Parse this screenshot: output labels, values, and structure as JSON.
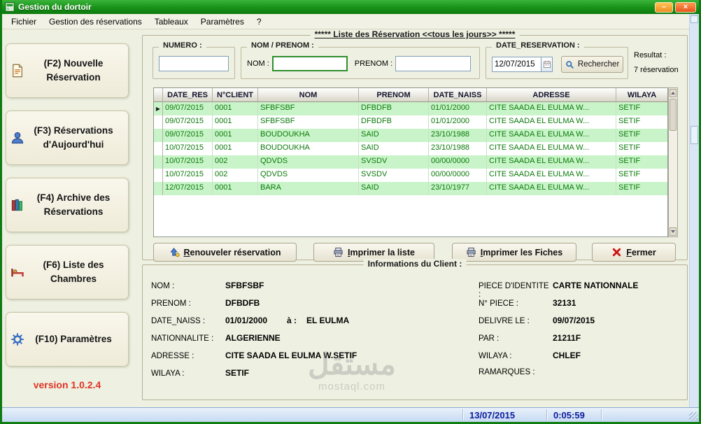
{
  "window": {
    "title": "Gestion du dortoir",
    "minimize_glyph": "–",
    "close_glyph": "×"
  },
  "menu": {
    "items": [
      "Fichier",
      "Gestion des réservations",
      "Tableaux",
      "Paramètres",
      "?"
    ]
  },
  "sidebar": {
    "buttons": [
      {
        "name": "f2-nouvelle-reservation-button",
        "icon": "document-icon",
        "label": "(F2) Nouvelle Réservation"
      },
      {
        "name": "f3-reservations-aujourdhui-button",
        "icon": "person-icon",
        "label": "(F3) Réservations d'Aujourd'hui"
      },
      {
        "name": "f4-archive-reservations-button",
        "icon": "archive-icon",
        "label": "(F4) Archive des Réservations"
      },
      {
        "name": "f6-liste-chambres-button",
        "icon": "rooms-icon",
        "label": "(F6) Liste des Chambres"
      },
      {
        "name": "f10-parametres-button",
        "icon": "settings-icon",
        "label": "(F10) Paramètres"
      }
    ],
    "version": "version 1.0.2.4"
  },
  "list": {
    "title": "***** Liste des Réservation <<tous les jours>> *****",
    "numero_group": {
      "caption": "NUMERO :",
      "value": ""
    },
    "nom_prenom_group": {
      "caption": "NOM / PRENOM :",
      "nom_label": "NOM :",
      "nom_value": "",
      "prenom_label": "PRENOM :",
      "prenom_value": ""
    },
    "date_group": {
      "caption": "DATE_RESERVATION :",
      "date_value": "12/07/2015",
      "search_button": "Rechercher"
    },
    "result_label": "Resultat :",
    "result_value": "7 réservation"
  },
  "table": {
    "columns": [
      "DATE_RES",
      "N°CLIENT",
      "NOM",
      "PRENOM",
      "DATE_NAISS",
      "ADRESSE",
      "WILAYA"
    ],
    "rows": [
      [
        "09/07/2015",
        "0001",
        "SFBFSBF",
        "DFBDFB",
        "01/01/2000",
        "CITE SAADA EL EULMA W...",
        "SETIF"
      ],
      [
        "09/07/2015",
        "0001",
        "SFBFSBF",
        "DFBDFB",
        "01/01/2000",
        "CITE SAADA EL EULMA W...",
        "SETIF"
      ],
      [
        "09/07/2015",
        "0001",
        "BOUDOUKHA",
        "SAID",
        "23/10/1988",
        "CITE SAADA EL EULMA W...",
        "SETIF"
      ],
      [
        "10/07/2015",
        "0001",
        "BOUDOUKHA",
        "SAID",
        "23/10/1988",
        "CITE SAADA EL EULMA W...",
        "SETIF"
      ],
      [
        "10/07/2015",
        "002",
        "QDVDS",
        "SVSDV",
        "00/00/0000",
        "CITE SAADA EL EULMA W...",
        "SETIF"
      ],
      [
        "10/07/2015",
        "002",
        "QDVDS",
        "SVSDV",
        "00/00/0000",
        "CITE SAADA EL EULMA W...",
        "SETIF"
      ],
      [
        "12/07/2015",
        "0001",
        "BARA",
        "SAID",
        "23/10/1977",
        "CITE SAADA EL EULMA W...",
        "SETIF"
      ]
    ],
    "selected_row_index": 0,
    "selected_indicator": "▶"
  },
  "actions": [
    {
      "name": "renouveler-reservation-button",
      "icon": "renew-icon",
      "label": "Renouveler réservation"
    },
    {
      "name": "imprimer-liste-button",
      "icon": "printer-icon",
      "label": "Imprimer la liste"
    },
    {
      "name": "imprimer-fiches-button",
      "icon": "printer-icon",
      "label": "Imprimer les Fiches"
    },
    {
      "name": "fermer-button",
      "icon": "close-x-icon",
      "label": "Fermer"
    }
  ],
  "client": {
    "title": "Informations du Client :",
    "left": [
      {
        "label": "NOM :",
        "value": "SFBFSBF"
      },
      {
        "label": "PRENOM :",
        "value": "DFBDFB"
      },
      {
        "label": "DATE_NAISS :",
        "value": "01/01/2000",
        "label2": "à :",
        "value2": "EL EULMA"
      },
      {
        "label": "NATIONNALITE :",
        "value": "ALGERIENNE"
      },
      {
        "label": "ADRESSE :",
        "value": "CITE SAADA EL EULMA W.SETIF"
      },
      {
        "label": "WILAYA :",
        "value": "SETIF"
      }
    ],
    "right": [
      {
        "label": "PIECE D'IDENTITE :",
        "value": "CARTE NATIONNALE"
      },
      {
        "label": "N° PIECE :",
        "value": "32131"
      },
      {
        "label": "DELIVRE LE :",
        "value": "09/07/2015"
      },
      {
        "label": "PAR :",
        "value": "21211F"
      },
      {
        "label": "WILAYA :",
        "value": "CHLEF"
      },
      {
        "label": "RAMARQUES :",
        "value": ""
      }
    ]
  },
  "statusbar": {
    "date": "13/07/2015",
    "time": "0:05:59"
  },
  "watermark": {
    "line1": "مستقل",
    "line2": "mostaql.com"
  }
}
